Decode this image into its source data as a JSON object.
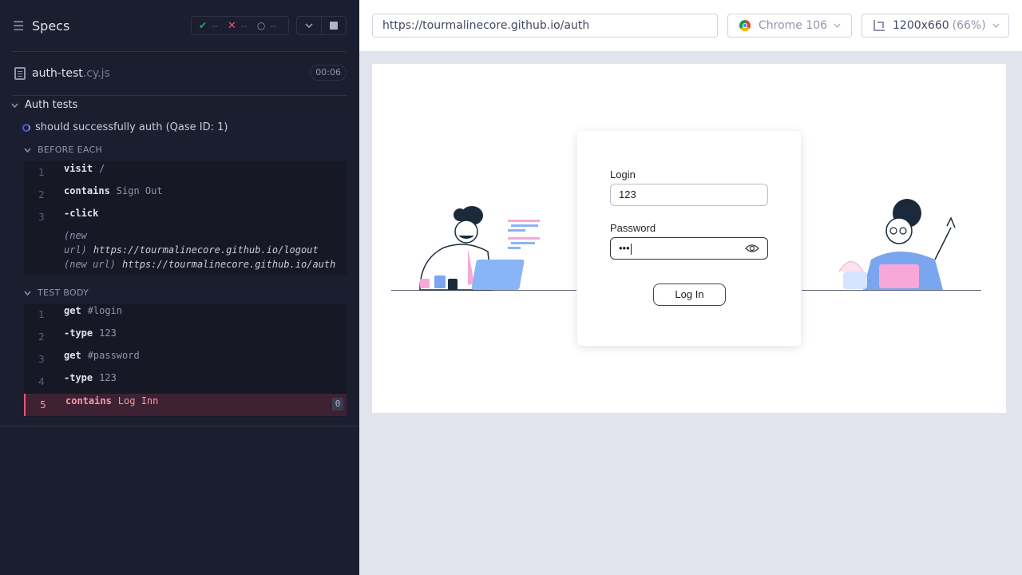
{
  "reporter": {
    "title": "Specs",
    "stats": {
      "passed": "--",
      "failed": "--",
      "pending": "--"
    },
    "spec": {
      "name": "auth-test",
      "ext": ".cy.js",
      "duration": "00:06"
    },
    "suite": "Auth tests",
    "test": "should successfully auth (Qase ID: 1)",
    "before_each": {
      "label": "BEFORE EACH",
      "commands": [
        {
          "num": "1",
          "name": "visit",
          "arg": "/"
        },
        {
          "num": "2",
          "name": "contains",
          "arg": "Sign Out"
        },
        {
          "num": "3",
          "name": "-click",
          "arg": ""
        }
      ],
      "url_logs": [
        {
          "prefix": "(new url)",
          "url": "https://tourmalinecore.github.io/logout"
        },
        {
          "prefix": "(new url)",
          "url": "https://tourmalinecore.github.io/auth"
        }
      ]
    },
    "test_body": {
      "label": "TEST BODY",
      "commands": [
        {
          "num": "1",
          "name": "get",
          "arg": "#login"
        },
        {
          "num": "2",
          "name": "-type",
          "arg": "123"
        },
        {
          "num": "3",
          "name": "get",
          "arg": "#password"
        },
        {
          "num": "4",
          "name": "-type",
          "arg": "123"
        },
        {
          "num": "5",
          "name": "contains",
          "arg": "Log Inn",
          "badge": "0"
        }
      ]
    }
  },
  "aut": {
    "url": "https://tourmalinecore.github.io/auth",
    "browser": "Chrome 106",
    "viewport": "1200x660",
    "scale": "(66%)",
    "form": {
      "login_label": "Login",
      "login_value": "123",
      "password_label": "Password",
      "password_value": "•••",
      "button": "Log In"
    }
  },
  "colors": {
    "pass": "#1fa971",
    "fail": "#e45770",
    "accent": "#4956e3",
    "bg": "#1b1e2e"
  },
  "icons": [
    "menu-icon",
    "check-icon",
    "x-icon",
    "spinner-icon",
    "chevron-down-icon",
    "stop-icon",
    "file-icon",
    "chrome-icon",
    "viewport-icon",
    "eye-icon"
  ]
}
